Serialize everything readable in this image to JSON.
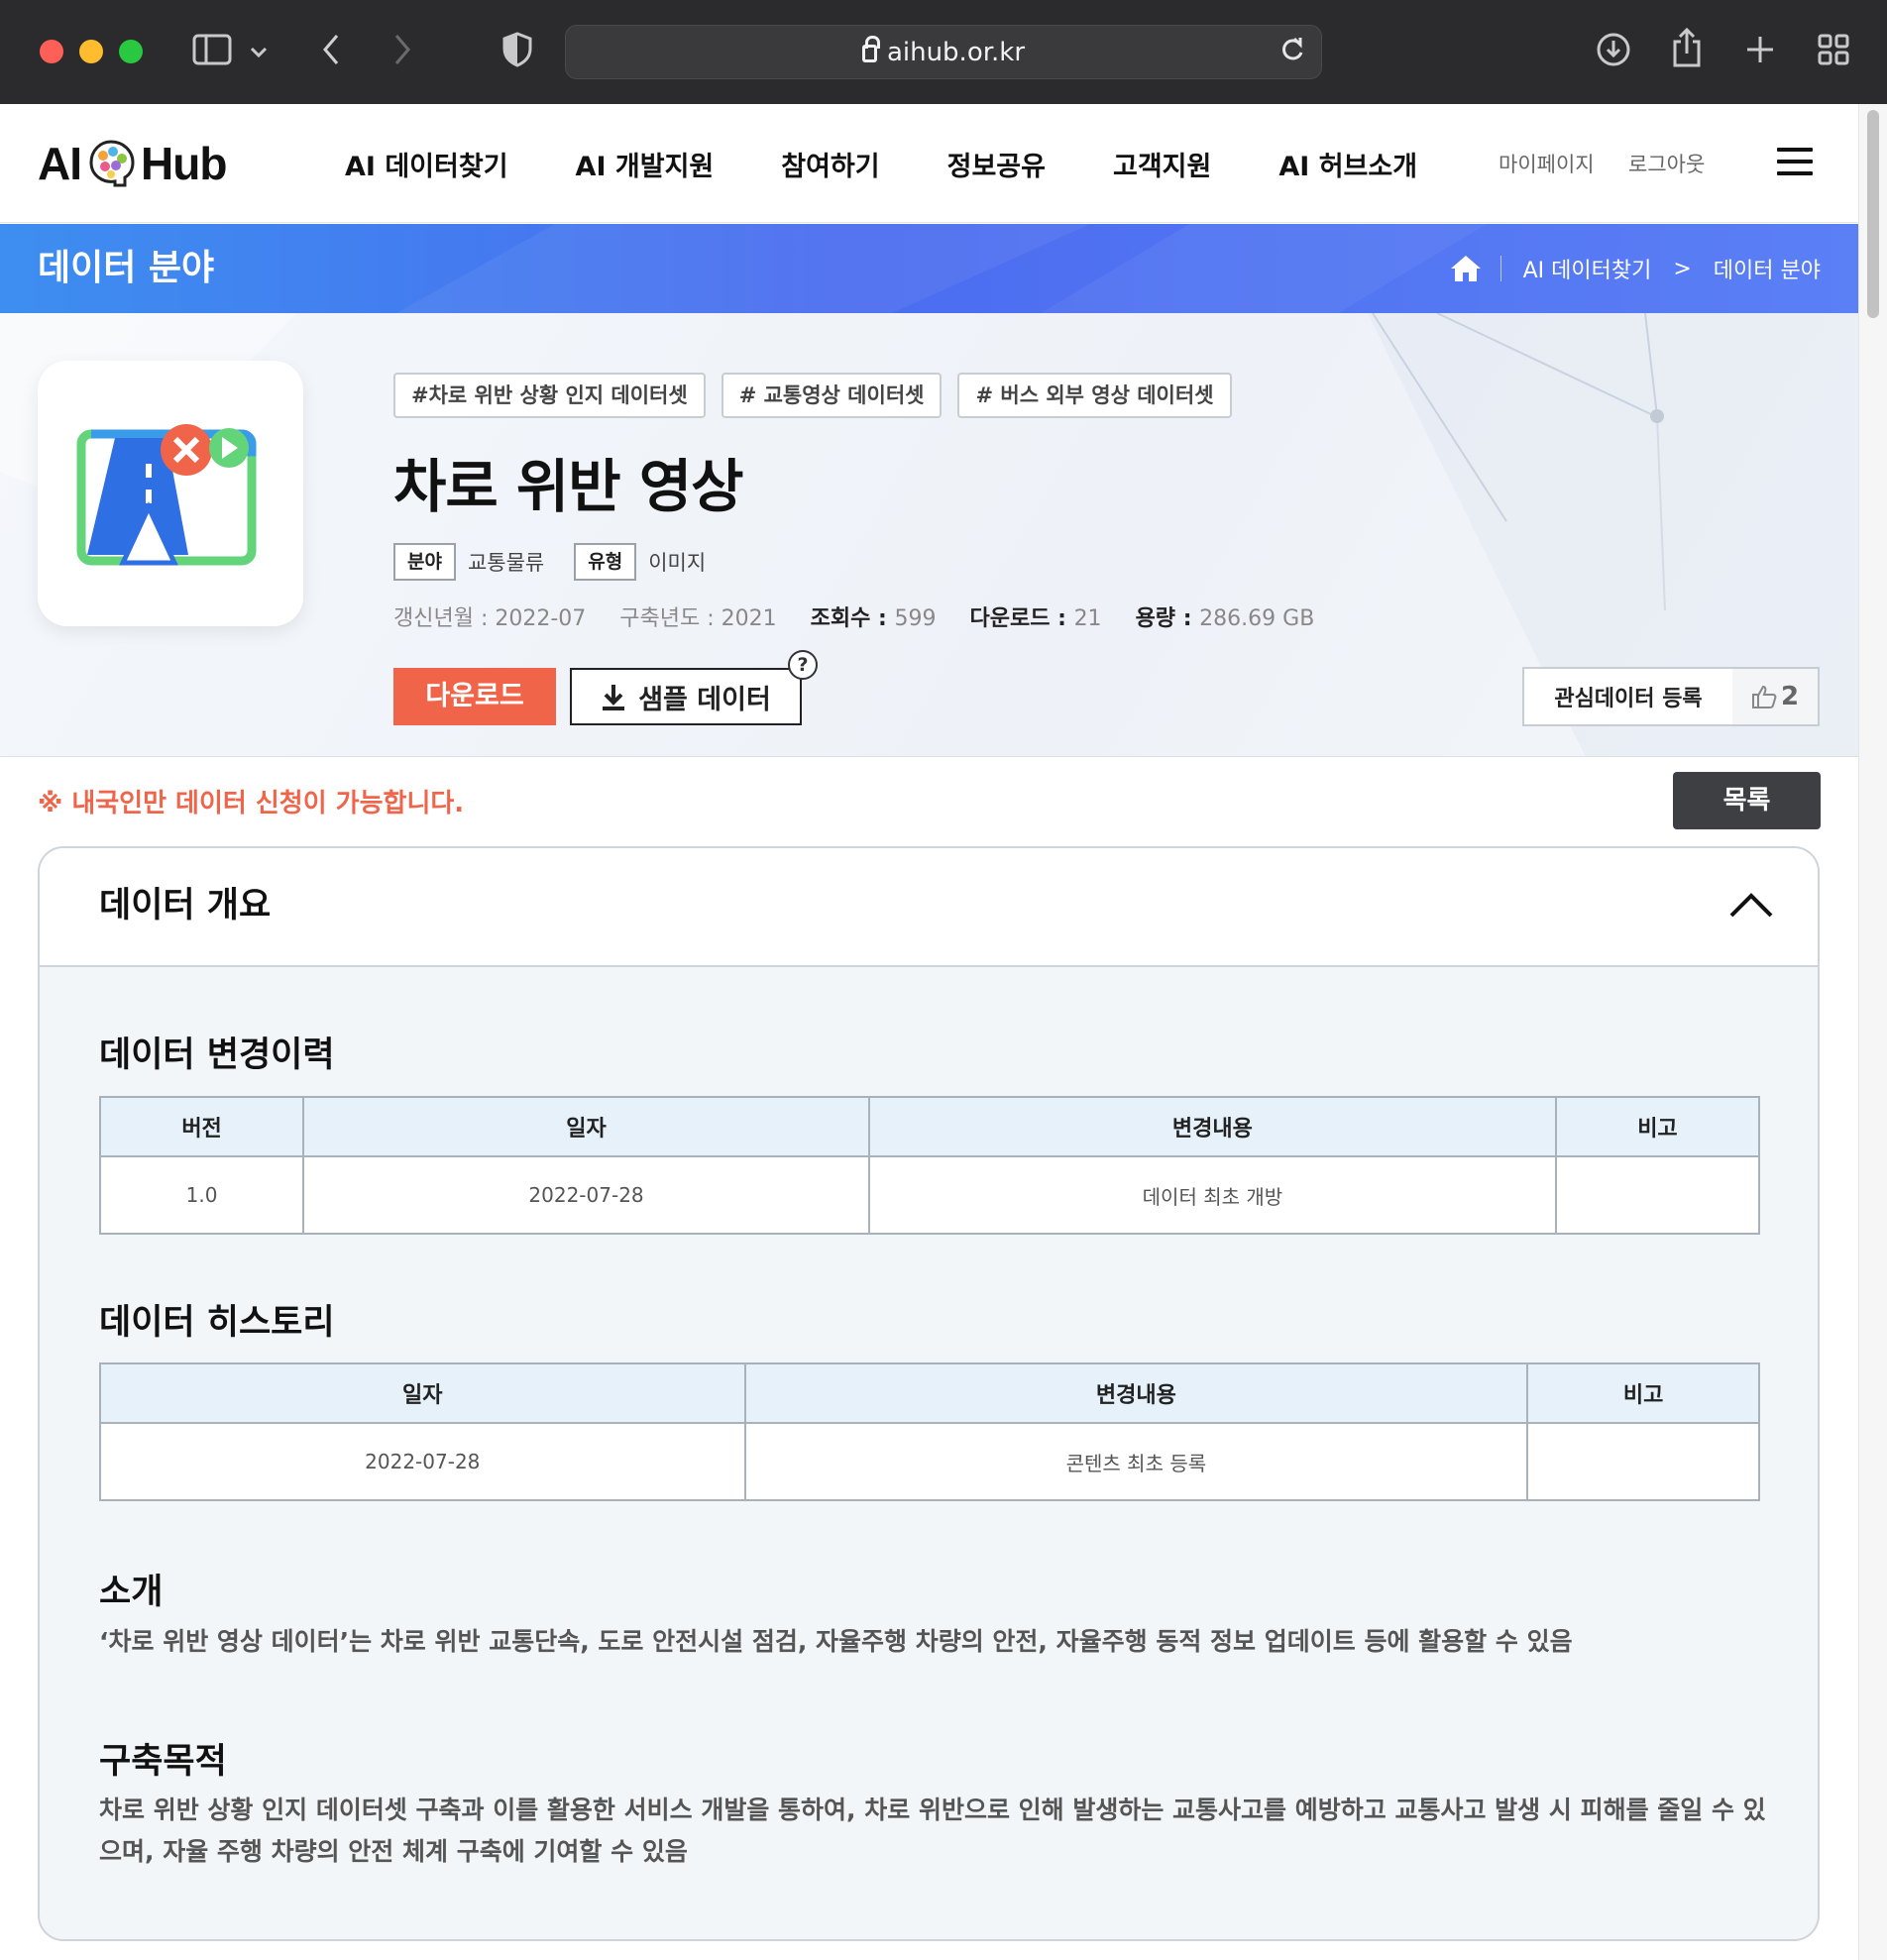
{
  "browser": {
    "url": "aihub.or.kr"
  },
  "header": {
    "logo_left": "AI",
    "logo_right": "Hub",
    "nav": [
      "AI 데이터찾기",
      "AI 개발지원",
      "참여하기",
      "정보공유",
      "고객지원",
      "AI 허브소개"
    ],
    "util": [
      "마이페이지",
      "로그아웃"
    ]
  },
  "banner": {
    "title": "데이터 분야",
    "breadcrumb": [
      "AI 데이터찾기",
      ">",
      "데이터 분야"
    ]
  },
  "dataset": {
    "tags": [
      "#차로 위반 상황 인지 데이터셋",
      "# 교통영상 데이터셋",
      "# 버스 외부 영상 데이터셋"
    ],
    "title": "차로 위반 영상",
    "field_label": "분야",
    "field_value": "교통물류",
    "type_label": "유형",
    "type_value": "이미지",
    "stats": {
      "updated": "갱신년월 : 2022-07",
      "built": "구축년도 : 2021",
      "views_label": "조회수 : ",
      "views": "599",
      "downloads_label": "다운로드 : ",
      "downloads": "21",
      "size_label": "용량 : ",
      "size": "286.69 GB"
    },
    "download_button": "다운로드",
    "sample_button": "샘플 데이터",
    "help": "?",
    "favorite_button": "관심데이터 등록",
    "likes": "2"
  },
  "notice": "※ 내국인만 데이터 신청이 가능합니다.",
  "list_button": "목록",
  "overview": {
    "title": "데이터 개요",
    "change_history": {
      "title": "데이터 변경이력",
      "headers": [
        "버전",
        "일자",
        "변경내용",
        "비고"
      ],
      "rows": [
        [
          "1.0",
          "2022-07-28",
          "데이터 최초 개방",
          ""
        ]
      ]
    },
    "history": {
      "title": "데이터 히스토리",
      "headers": [
        "일자",
        "변경내용",
        "비고"
      ],
      "rows": [
        [
          "2022-07-28",
          "콘텐츠 최초 등록",
          ""
        ]
      ]
    },
    "intro": {
      "title": "소개",
      "text": "‘차로 위반 영상 데이터’는 차로 위반 교통단속, 도로 안전시설 점검, 자율주행 차량의 안전, 자율주행 동적 정보 업데이트 등에 활용할 수 있음"
    },
    "purpose": {
      "title": "구축목적",
      "text": "차로 위반 상황 인지 데이터셋 구축과 이를 활용한 서비스 개발을 통하여, 차로 위반으로 인해 발생하는 교통사고를 예방하고 교통사고 발생 시 피해를 줄일 수 있으며, 자율 주행 차량의 안전 체계 구축에 기여할 수 있음"
    }
  },
  "colors": {
    "accent": "#f0654a",
    "banner": "#4a6cf0",
    "table_header": "#e6f1fa"
  }
}
